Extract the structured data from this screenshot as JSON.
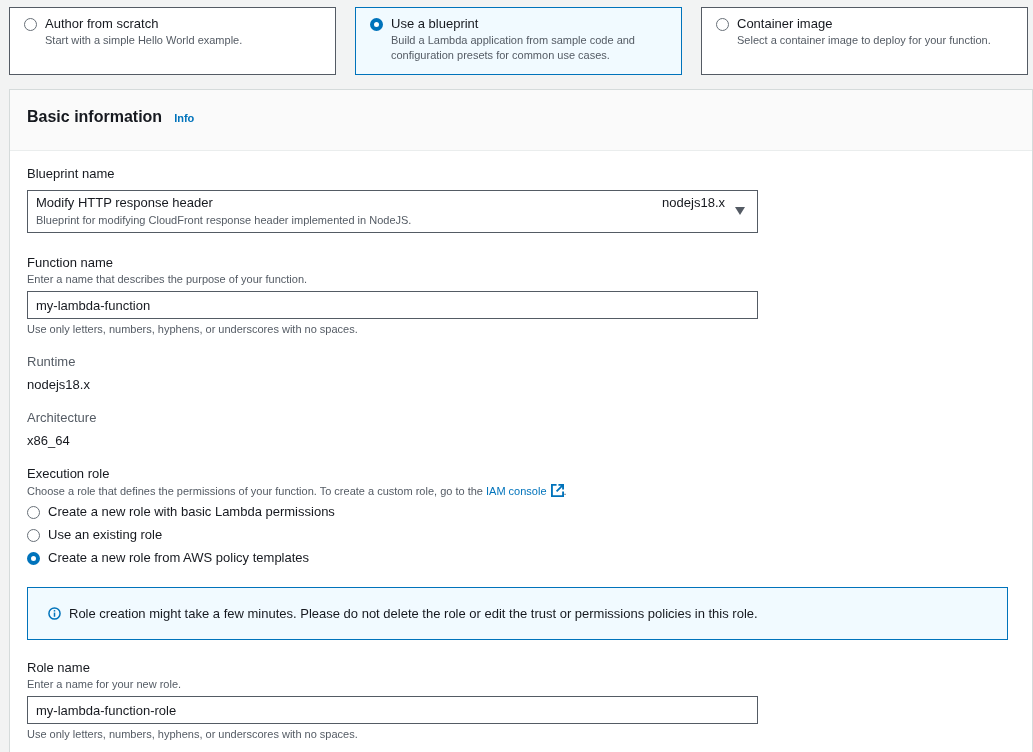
{
  "options": [
    {
      "title": "Author from scratch",
      "description": "Start with a simple Hello World example.",
      "selected": false
    },
    {
      "title": "Use a blueprint",
      "description": "Build a Lambda application from sample code and configuration presets for common use cases.",
      "selected": true
    },
    {
      "title": "Container image",
      "description": "Select a container image to deploy for your function.",
      "selected": false
    }
  ],
  "panel": {
    "title": "Basic information",
    "info_link": "Info",
    "blueprint": {
      "label": "Blueprint name",
      "value": "Modify HTTP response header",
      "description": "Blueprint for modifying CloudFront response header implemented in NodeJS.",
      "runtime_tag": "nodejs18.x"
    },
    "function_name": {
      "label": "Function name",
      "description": "Enter a name that describes the purpose of your function.",
      "value": "my-lambda-function",
      "constraint": "Use only letters, numbers, hyphens, or underscores with no spaces."
    },
    "runtime": {
      "label": "Runtime",
      "value": "nodejs18.x"
    },
    "architecture": {
      "label": "Architecture",
      "value": "x86_64"
    },
    "execution_role": {
      "label": "Execution role",
      "description_before": "Choose a role that defines the permissions of your function. To create a custom role, go to the ",
      "link": "IAM console",
      "description_after": ".",
      "choices": [
        {
          "label": "Create a new role with basic Lambda permissions",
          "selected": false
        },
        {
          "label": "Use an existing role",
          "selected": false
        },
        {
          "label": "Create a new role from AWS policy templates",
          "selected": true
        }
      ]
    },
    "alert": "Role creation might take a few minutes. Please do not delete the role or edit the trust or permissions policies in this role.",
    "role_name": {
      "label": "Role name",
      "description": "Enter a name for your new role.",
      "value": "my-lambda-function-role",
      "constraint": "Use only letters, numbers, hyphens, or underscores with no spaces."
    }
  }
}
